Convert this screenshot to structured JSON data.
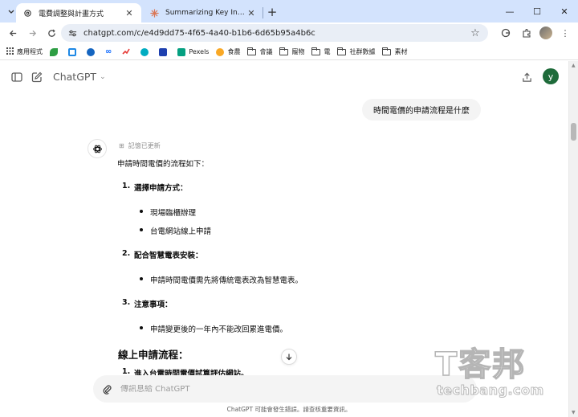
{
  "browser": {
    "tabs": [
      {
        "title": "電費調整與計畫方式",
        "active": true,
        "favicon": "openai-icon"
      },
      {
        "title": "Summarizing Key Information",
        "active": false,
        "favicon": "claude-icon"
      }
    ],
    "url": "chatgpt.com/c/e4d9dd75-4f65-4a40-b1b6-6d65b95a4b6c",
    "bookmarks": [
      {
        "label": "應用程式",
        "icon": "apps-grid-icon"
      },
      {
        "label": "",
        "icon": "leaf-icon",
        "color": "#2e9e44"
      },
      {
        "label": "",
        "icon": "square-icon",
        "color": "#1e88e5"
      },
      {
        "label": "",
        "icon": "c-icon",
        "color": "#1565c0"
      },
      {
        "label": "",
        "icon": "meta-icon",
        "color": "#0866ff"
      },
      {
        "label": "",
        "icon": "chart-icon",
        "color": "#e53935"
      },
      {
        "label": "",
        "icon": "s-icon",
        "color": "#00acc1"
      },
      {
        "label": "",
        "icon": "p-icon",
        "color": "#1e40af"
      },
      {
        "label": "Pexels",
        "icon": "pexels-icon",
        "color": "#05a081"
      },
      {
        "label": "食農",
        "icon": "bee-icon",
        "color": "#f9a825"
      },
      {
        "label": "會議",
        "icon": "folder-icon"
      },
      {
        "label": "寵物",
        "icon": "folder-icon"
      },
      {
        "label": "電",
        "icon": "folder-icon"
      },
      {
        "label": "社群數據",
        "icon": "folder-icon"
      },
      {
        "label": "素材",
        "icon": "folder-icon"
      }
    ]
  },
  "app": {
    "model_name": "ChatGPT",
    "avatar_letter": "y",
    "user_message": "時間電價的申請流程是什麼",
    "memory_note": "記憶已更新",
    "answer": {
      "intro": "申請時間電價的流程如下：",
      "sections": [
        {
          "num": "1.",
          "title": "選擇申請方式：",
          "bullets": [
            "現場臨櫃辦理",
            "台電網站線上申請"
          ]
        },
        {
          "num": "2.",
          "title": "配合智慧電表安裝：",
          "bullets": [
            "申請時間電價需先將傳統電表改為智慧電表。"
          ]
        },
        {
          "num": "3.",
          "title": "注意事項：",
          "bullets": [
            "申請變更後的一年內不能改回累進電價。"
          ]
        }
      ],
      "heading": "線上申請流程：",
      "next_item_num": "1.",
      "next_item": "進入台電時間電價試算評估網站。"
    },
    "composer_placeholder": "傳訊息給 ChatGPT",
    "disclaimer": "ChatGPT 可能會發生錯誤。請查核重要資訊。"
  },
  "watermark": {
    "logo_text": "T客邦",
    "site": "techbang.com"
  }
}
